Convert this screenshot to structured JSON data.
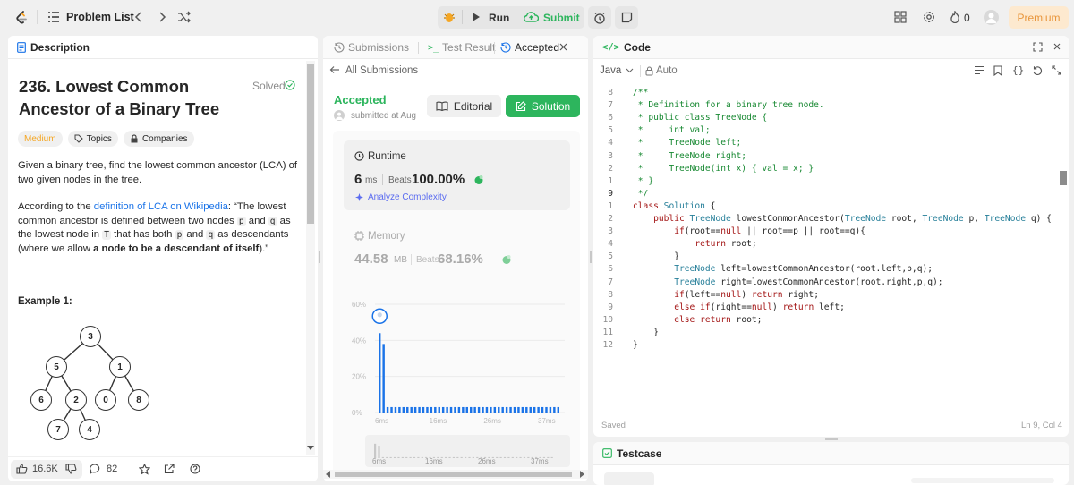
{
  "topbar": {
    "problem_list": "Problem List",
    "run": "Run",
    "submit": "Submit",
    "streak": "0",
    "premium": "Premium"
  },
  "description": {
    "tab": "Description",
    "title": "236. Lowest Common Ancestor of a Binary Tree",
    "solved": "Solved",
    "difficulty": "Medium",
    "topics": "Topics",
    "companies": "Companies",
    "p1": "Given a binary tree, find the lowest common ancestor (LCA) of two given nodes in the tree.",
    "p2_a": "According to the ",
    "p2_link": "definition of LCA on Wikipedia",
    "p2_b": ": “The lowest common ancestor is defined between two nodes ",
    "p2_p": "p",
    "p2_c": " and ",
    "p2_q": "q",
    "p2_d": " as the lowest node in ",
    "p2_T": "T",
    "p2_e": " that has both ",
    "p2_p2": "p",
    "p2_f": " and ",
    "p2_q2": "q",
    "p2_g": " as descendants (where we allow ",
    "p2_bold": "a node to be a descendant of itself",
    "p2_h": ").”",
    "example": "Example 1:",
    "tree_nodes": [
      "3",
      "5",
      "1",
      "6",
      "2",
      "0",
      "8",
      "7",
      "4"
    ],
    "likes": "16.6K",
    "comments": "82"
  },
  "submission": {
    "tab_submissions": "Submissions",
    "tab_test": "Test Result",
    "tab_accepted": "Accepted",
    "back": "All Submissions",
    "status": "Accepted",
    "submitted": "submitted at Aug",
    "editorial": "Editorial",
    "solution": "Solution",
    "runtime_label": "Runtime",
    "runtime_value": "6",
    "runtime_unit": "ms",
    "beats_label": "Beats",
    "runtime_beats": "100.00%",
    "analyze": "Analyze Complexity",
    "memory_label": "Memory",
    "memory_value": "44.58",
    "memory_unit": "MB",
    "memory_beats": "68.16%",
    "colors": {
      "accent": "#2db55d",
      "bar": "#1a73e8",
      "bar_muted": "#7a9fd8"
    }
  },
  "chart_data": {
    "type": "bar",
    "yticks": [
      "60%",
      "40%",
      "20%",
      "0%"
    ],
    "xticks": [
      "6ms",
      "16ms",
      "26ms",
      "37ms"
    ],
    "ylim": [
      0,
      60
    ],
    "values": [
      44,
      38,
      3,
      3,
      3,
      3,
      3,
      3,
      3,
      3,
      3,
      3,
      3,
      3,
      3,
      3,
      3,
      3,
      3,
      3,
      3,
      3,
      3,
      3,
      3,
      3,
      3,
      3,
      3,
      3,
      3,
      3,
      3,
      3,
      3,
      3,
      3,
      3,
      3,
      3,
      3,
      3,
      3,
      3,
      3,
      3
    ]
  },
  "code": {
    "tab": "Code",
    "language": "Java",
    "auto": "Auto",
    "saved": "Saved",
    "cursor": "Ln 9, Col 4",
    "lines": [
      {
        "n": "8",
        "t": "/**"
      },
      {
        "n": "7",
        "t": " * Definition for a binary tree node."
      },
      {
        "n": "6",
        "t": " * public class TreeNode {"
      },
      {
        "n": "5",
        "t": " *     int val;"
      },
      {
        "n": "4",
        "t": " *     TreeNode left;"
      },
      {
        "n": "3",
        "t": " *     TreeNode right;"
      },
      {
        "n": "2",
        "t": " *     TreeNode(int x) { val = x; }"
      },
      {
        "n": "1",
        "t": " * }"
      },
      {
        "n": "9",
        "t": " */"
      },
      {
        "n": "1",
        "t": "class Solution {"
      },
      {
        "n": "2",
        "t": "    public TreeNode lowestCommonAncestor(TreeNode root, TreeNode p, TreeNode q) {"
      },
      {
        "n": "3",
        "t": "        if(root==null || root==p || root==q){"
      },
      {
        "n": "4",
        "t": "            return root;"
      },
      {
        "n": "5",
        "t": "        }"
      },
      {
        "n": "6",
        "t": "        TreeNode left=lowestCommonAncestor(root.left,p,q);"
      },
      {
        "n": "7",
        "t": "        TreeNode right=lowestCommonAncestor(root.right,p,q);"
      },
      {
        "n": "8",
        "t": "        if(left==null) return right;"
      },
      {
        "n": "9",
        "t": "        else if(right==null) return left;"
      },
      {
        "n": "10",
        "t": "        else return root;"
      },
      {
        "n": "11",
        "t": "    }"
      },
      {
        "n": "12",
        "t": "}"
      }
    ]
  },
  "testcase": {
    "tab": "Testcase"
  }
}
